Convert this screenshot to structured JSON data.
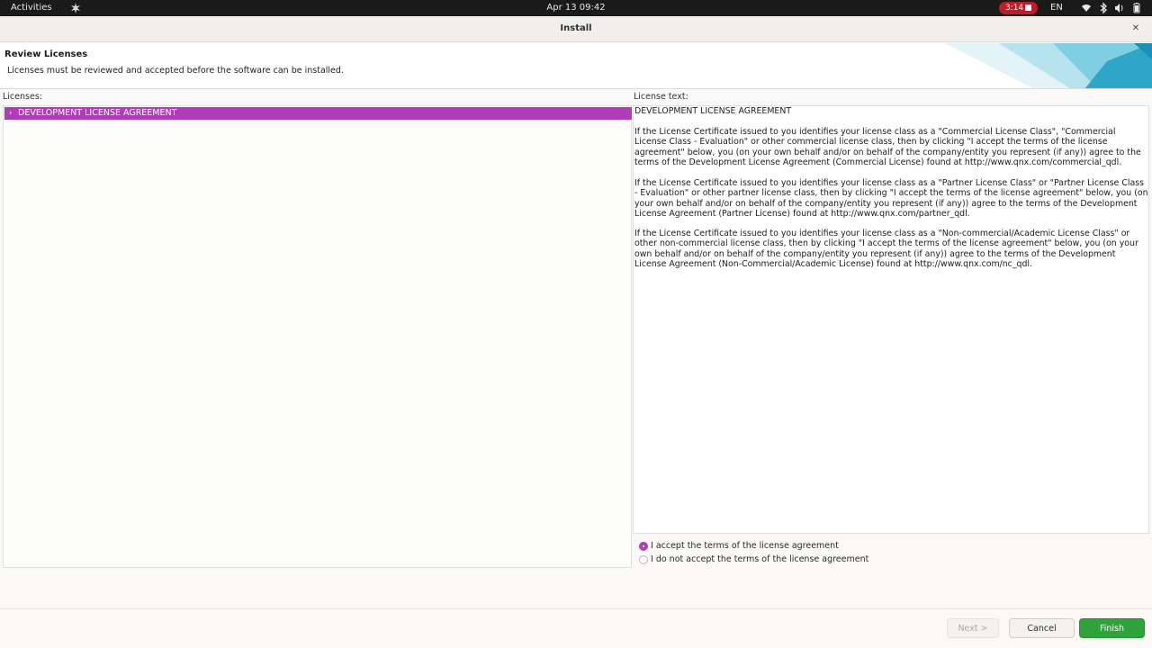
{
  "topbar": {
    "activities": "Activities",
    "clock": "Apr 13  09:42",
    "recording_time": "3:14",
    "language": "EN",
    "tray_icons": [
      "wifi-icon",
      "bluetooth-icon",
      "volume-icon",
      "battery-icon"
    ]
  },
  "window": {
    "title": "Install"
  },
  "header": {
    "title": "Review Licenses",
    "description": "Licenses must be reviewed and accepted before the software can be installed."
  },
  "licenses": {
    "label": "Licenses:",
    "items": [
      {
        "label": "DEVELOPMENT LICENSE AGREEMENT",
        "selected": true
      }
    ]
  },
  "license_text": {
    "label": "License text:",
    "title": "DEVELOPMENT LICENSE AGREEMENT",
    "paragraphs": [
      "If the License Certificate issued to you identifies your license class as a \"Commercial License Class\", \"Commercial License Class - Evaluation\" or other commercial license class, then by clicking \"I accept the terms of the license agreement\" below, you (on your own behalf and/or on behalf of the company/entity you represent (if any)) agree to the terms of the Development License Agreement (Commercial License) found at http://www.qnx.com/commercial_qdl.",
      "If the License Certificate issued to you identifies your license class as a \"Partner License Class\" or \"Partner License Class - Evaluation\" or other partner license class, then by clicking \"I accept the terms of the license agreement\" below, you (on your own behalf and/or on behalf of the company/entity you represent (if any)) agree to the terms of the Development License Agreement (Partner License) found at http://www.qnx.com/partner_qdl.",
      "If the License Certificate issued to you identifies your license class as a \"Non-commercial/Academic License Class\" or other non-commercial license class, then by clicking \"I accept the terms of the license agreement\" below, you (on your own behalf and/or on behalf of the company/entity you represent (if any)) agree to the terms of the Development License Agreement (Non-Commercial/Academic License) found at http://www.qnx.com/nc_qdl."
    ]
  },
  "options": {
    "accept": "I accept the terms of the license agreement",
    "decline": "I do not accept the terms of the license agreement",
    "selected": "accept"
  },
  "buttons": {
    "next": "Next >",
    "cancel": "Cancel",
    "finish": "Finish"
  },
  "colors": {
    "accent": "#b03cb8",
    "finish": "#2ea33a",
    "recording": "#c01c28"
  }
}
